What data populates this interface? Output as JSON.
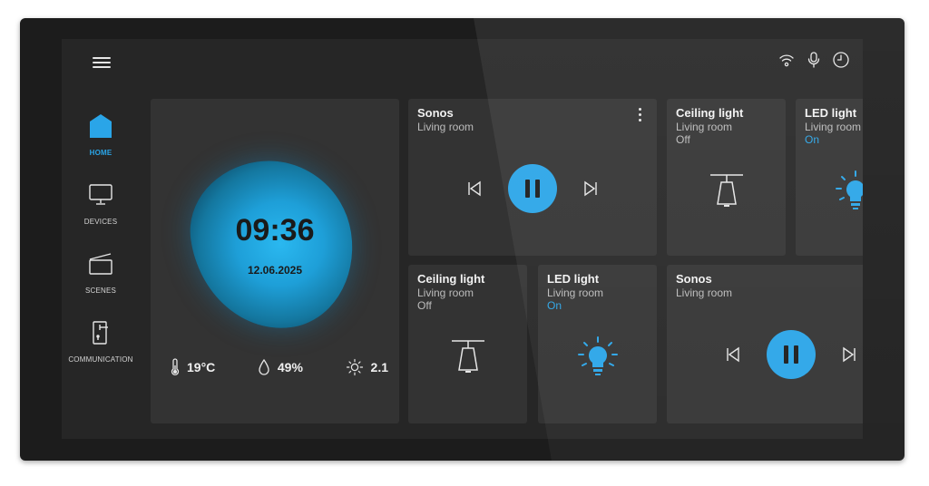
{
  "nav": {
    "items": [
      {
        "label": "HOME",
        "icon": "home-icon",
        "active": true
      },
      {
        "label": "DEVICES",
        "icon": "monitor-icon",
        "active": false
      },
      {
        "label": "SCENES",
        "icon": "scenes-icon",
        "active": false
      },
      {
        "label": "COMMUNICATION",
        "icon": "door-entry-icon",
        "active": false
      }
    ]
  },
  "status_icons": [
    "wifi-icon",
    "microphone-icon",
    "clock-icon"
  ],
  "clock": {
    "time": "09:36",
    "date": "12.06.2025",
    "temperature": "19°C",
    "humidity": "49%",
    "uv": "2.1"
  },
  "cards": {
    "sonos_top": {
      "title": "Sonos",
      "room": "Living room"
    },
    "ceiling_top": {
      "title": "Ceiling light",
      "room": "Living room",
      "state": "Off"
    },
    "led_top": {
      "title": "LED light",
      "room": "Living room",
      "state": "On"
    },
    "ceiling_bottom": {
      "title": "Ceiling light",
      "room": "Living room",
      "state": "Off"
    },
    "led_bottom": {
      "title": "LED light",
      "room": "Living room",
      "state": "On"
    },
    "sonos_bottom": {
      "title": "Sonos",
      "room": "Living room"
    }
  },
  "colors": {
    "accent": "#2aa5e8",
    "card": "#333333",
    "screen": "#262626",
    "bezel": "#1c1c1c"
  }
}
